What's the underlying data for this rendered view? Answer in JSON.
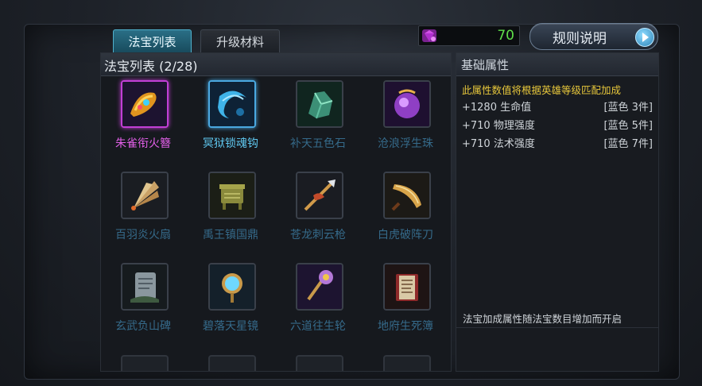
{
  "tabs": {
    "active": "法宝列表",
    "inactive": "升级材料"
  },
  "currency": {
    "value": "70",
    "icon": "gem-icon",
    "color": "#c43fe0"
  },
  "rules_button": {
    "label": "规则说明",
    "icon": "play-arrow-icon"
  },
  "list": {
    "title": "法宝列表 (2/28)",
    "items": [
      {
        "name": "朱雀衔火簪",
        "icon": "phoenix-hairpin-icon",
        "state": "selected-pink"
      },
      {
        "name": "冥狱锁魂钩",
        "icon": "soul-hook-icon",
        "state": "selected-blue"
      },
      {
        "name": "补天五色石",
        "icon": "five-color-stone-icon",
        "state": "locked"
      },
      {
        "name": "沧浪浮生珠",
        "icon": "pearl-icon",
        "state": "locked"
      },
      {
        "name": "百羽炎火扇",
        "icon": "feather-fan-icon",
        "state": "locked"
      },
      {
        "name": "禹王镇国鼎",
        "icon": "cauldron-icon",
        "state": "locked"
      },
      {
        "name": "苍龙刺云枪",
        "icon": "dragon-spear-icon",
        "state": "locked"
      },
      {
        "name": "白虎破阵刀",
        "icon": "tiger-blade-icon",
        "state": "locked"
      },
      {
        "name": "玄武负山碑",
        "icon": "stone-tablet-icon",
        "state": "locked"
      },
      {
        "name": "碧落天星镜",
        "icon": "star-mirror-icon",
        "state": "locked"
      },
      {
        "name": "六道往生轮",
        "icon": "rebirth-wheel-icon",
        "state": "locked"
      },
      {
        "name": "地府生死簿",
        "icon": "book-of-life-icon",
        "state": "locked"
      }
    ]
  },
  "attributes": {
    "title": "基础属性",
    "description": "此属性数值将根据英雄等级匹配加成",
    "stats": [
      {
        "value": "+1280 生命值",
        "requirement": "[蓝色 3件]"
      },
      {
        "value": "+710 物理强度",
        "requirement": "[蓝色 5件]"
      },
      {
        "value": "+710 法术强度",
        "requirement": "[蓝色 7件]"
      }
    ],
    "footer": "法宝加成属性随法宝数目增加而开启"
  }
}
